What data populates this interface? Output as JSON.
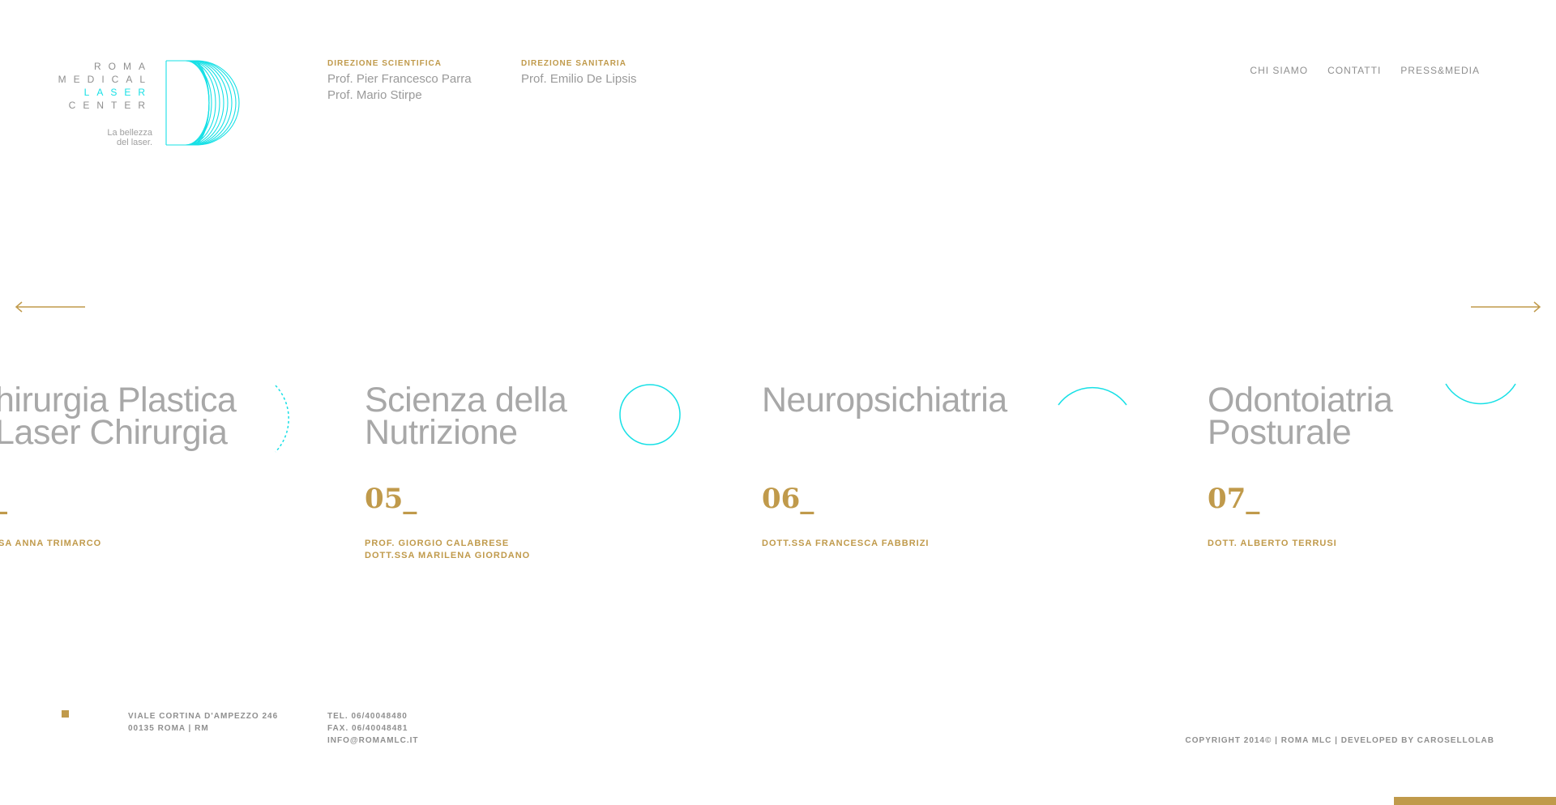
{
  "logo": {
    "line1": "ROMA",
    "line2": "MEDICAL",
    "line3": "LASER",
    "line4": "CENTER",
    "tagline1": "La bellezza",
    "tagline2": "del laser.",
    "accent": "#17e0e6"
  },
  "header": {
    "direzione_scientifica": {
      "label": "DIREZIONE SCIENTIFICA",
      "names": [
        "Prof. Pier Francesco Parra",
        "Prof. Mario Stirpe"
      ]
    },
    "direzione_sanitaria": {
      "label": "DIREZIONE SANITARIA",
      "names": [
        "Prof. Emilio De Lipsis"
      ]
    }
  },
  "nav": [
    "CHI SIAMO",
    "CONTATTI",
    "PRESS&MEDIA"
  ],
  "arrows": {
    "prev": "arrow-left-icon",
    "next": "arrow-right-icon"
  },
  "slides": [
    {
      "title": [
        "hirurgia Plastica",
        "Laser Chirurgia"
      ],
      "number": "_",
      "doctors": [
        "SA ANNA TRIMARCO"
      ]
    },
    {
      "title": [
        "Scienza della",
        "Nutrizione"
      ],
      "number": "05_",
      "doctors": [
        "PROF. GIORGIO CALABRESE",
        "DOTT.SSA MARILENA GIORDANO"
      ]
    },
    {
      "title": [
        "Neuropsichiatria"
      ],
      "number": "06_",
      "doctors": [
        "DOTT.SSA FRANCESCA FABBRIZI"
      ]
    },
    {
      "title": [
        "Odontoiatria",
        "Posturale"
      ],
      "number": "07_",
      "doctors": [
        "DOTT. ALBERTO TERRUSI"
      ]
    }
  ],
  "footer": {
    "address": [
      "VIALE CORTINA D'AMPEZZO 246",
      "00135 ROMA | RM"
    ],
    "contacts": [
      "TEL. 06/40048480",
      "FAX. 06/40048481",
      "INFO@ROMAMLC.IT"
    ],
    "copyright": "COPYRIGHT 2014© | ROMA MLC | DEVELOPED BY CAROSELLOLAB"
  },
  "colors": {
    "gold": "#c09a4b",
    "cyan": "#17e0e6",
    "gray": "#9a9a9a"
  }
}
